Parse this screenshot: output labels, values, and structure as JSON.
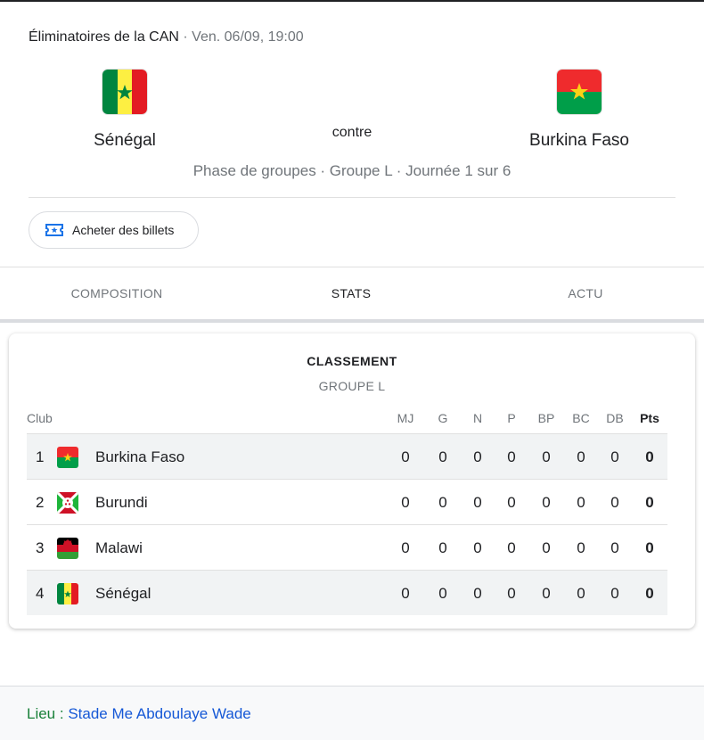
{
  "match": {
    "competition": "Éliminatoires de la CAN",
    "separator": " · ",
    "date": "Ven. 06/09, 19:00",
    "versus": "contre",
    "phase": "Phase de groupes · Groupe L · Journée 1 sur 6",
    "home": {
      "name": "Sénégal",
      "flag": "senegal-flag"
    },
    "away": {
      "name": "Burkina Faso",
      "flag": "burkina-faso-flag"
    }
  },
  "tickets": {
    "label": "Acheter des billets",
    "icon": "ticket-icon"
  },
  "tabs": [
    {
      "label": "COMPOSITION",
      "active": false
    },
    {
      "label": "STATS",
      "active": true
    },
    {
      "label": "ACTU",
      "active": false
    }
  ],
  "standings": {
    "title": "CLASSEMENT",
    "subtitle": "GROUPE L",
    "columns": [
      "Club",
      "MJ",
      "G",
      "N",
      "P",
      "BP",
      "BC",
      "DB",
      "Pts"
    ],
    "rows": [
      {
        "rank": "1",
        "club": "Burkina Faso",
        "flag": "burkina-faso-flag",
        "highlight": true,
        "stats": [
          "0",
          "0",
          "0",
          "0",
          "0",
          "0",
          "0",
          "0"
        ]
      },
      {
        "rank": "2",
        "club": "Burundi",
        "flag": "burundi-flag",
        "highlight": false,
        "stats": [
          "0",
          "0",
          "0",
          "0",
          "0",
          "0",
          "0",
          "0"
        ]
      },
      {
        "rank": "3",
        "club": "Malawi",
        "flag": "malawi-flag",
        "highlight": false,
        "stats": [
          "0",
          "0",
          "0",
          "0",
          "0",
          "0",
          "0",
          "0"
        ]
      },
      {
        "rank": "4",
        "club": "Sénégal",
        "flag": "senegal-flag",
        "highlight": true,
        "stats": [
          "0",
          "0",
          "0",
          "0",
          "0",
          "0",
          "0",
          "0"
        ]
      }
    ]
  },
  "venue": {
    "label": "Lieu :",
    "name": "Stade Me Abdoulaye Wade"
  },
  "colors": {
    "link": "#1558d6",
    "venue_label": "#188038",
    "highlight_row": "#f1f3f4",
    "muted": "#70757a"
  }
}
